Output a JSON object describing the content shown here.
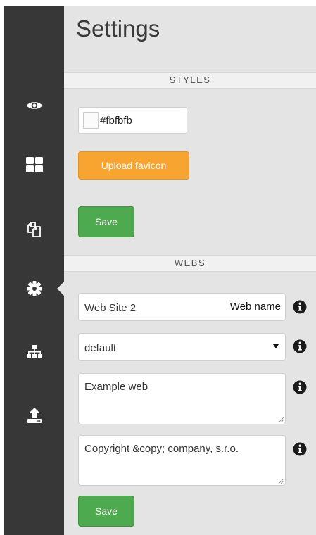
{
  "page": {
    "title": "Settings"
  },
  "sidebar": {
    "items": [
      {
        "icon": "eye-icon",
        "active": false
      },
      {
        "icon": "grid-icon",
        "active": false
      },
      {
        "icon": "copy-pages-icon",
        "active": false
      },
      {
        "icon": "gear-icon",
        "active": true
      },
      {
        "icon": "sitemap-icon",
        "active": false
      },
      {
        "icon": "upload-icon",
        "active": false
      }
    ]
  },
  "styles": {
    "header": "STYLES",
    "color_value": "#fbfbfb",
    "upload_label": "Upload favicon",
    "save_label": "Save"
  },
  "webs": {
    "header": "WEBS",
    "web_name_value": "Web Site 2",
    "web_name_label": "Web name",
    "template_value": "default",
    "description_value": "Example web",
    "copyright_value": "Copyright &copy; company, s.r.o.",
    "save_label": "Save"
  },
  "colors": {
    "sidebar_bg": "#373737",
    "main_bg": "#e4e4e4",
    "accent_orange": "#f7a431",
    "accent_green": "#4eaa4e"
  }
}
